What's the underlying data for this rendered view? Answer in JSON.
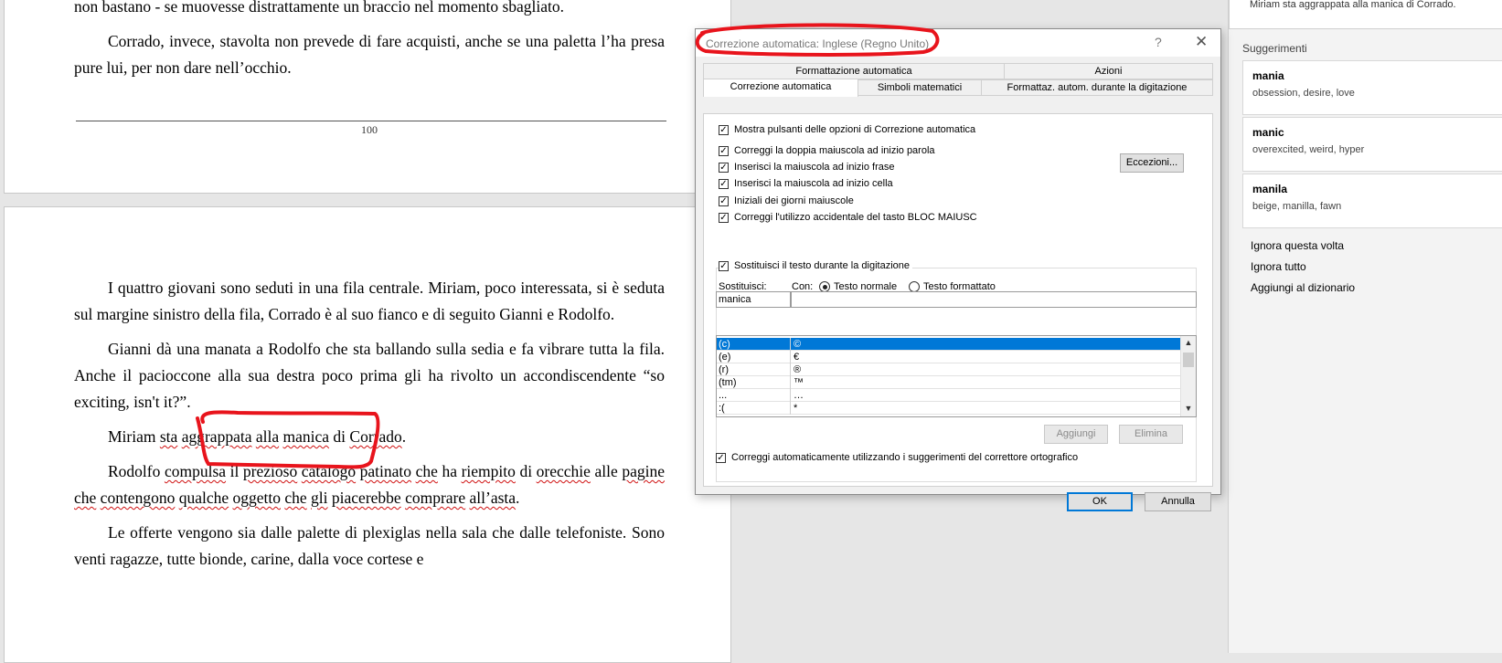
{
  "document": {
    "page1_paragraphs": [
      "non bastano - se muovesse distrattamente un braccio nel momento sbagliato.",
      "Corrado, invece, stavolta non prevede di fare acquisti, anche se una paletta l’ha presa pure lui, per non dare nell’occhio."
    ],
    "page_number": "100",
    "page2": {
      "p1": "I quattro giovani sono seduti in una fila centrale. Miriam, poco interessata, si è seduta sul margine sinistro della fila, Corrado è al suo fianco e di seguito Gianni e Rodolfo.",
      "p2": "Gianni dà una manata a Rodolfo che sta ballando sulla sedia e fa vibrare tutta la fila. Anche il pacioccone alla sua destra poco prima gli ha rivolto un accondiscendente “so exciting, isn't it?”.",
      "p3_words": [
        "Miriam ",
        "sta",
        " ",
        "aggrappata",
        " ",
        "alla",
        " ",
        "manica",
        " di ",
        "Corrado",
        "."
      ],
      "p4_words": [
        "Rodolfo ",
        "compulsa",
        " il ",
        "prezioso",
        " ",
        "catalogo",
        " ",
        "patinato",
        " ",
        "che",
        " ha ",
        "riempito",
        " di ",
        "orecchie",
        " alle ",
        "pagine",
        " ",
        "che",
        " ",
        "contengono",
        " ",
        "qualche",
        " ",
        "oggetto",
        " ",
        "che",
        " ",
        "gli",
        " ",
        "piacerebbe",
        " ",
        "comprare",
        " ",
        "all’asta",
        "."
      ],
      "p5": "Le offerte vengono sia dalle palette di plexiglas nella sala che dalle telefoniste. Sono venti ragazze, tutte bionde, carine, dalla voce cortese e"
    }
  },
  "pane": {
    "context": "Miriam sta aggrappata alla manica di Corrado.",
    "suggestions_header": "Suggerimenti",
    "suggestions": [
      {
        "word": "mania",
        "synonyms": "obsession, desire, love"
      },
      {
        "word": "manic",
        "synonyms": "overexcited, weird, hyper"
      },
      {
        "word": "manila",
        "synonyms": "beige, manilla, fawn"
      }
    ],
    "actions": [
      "Ignora questa volta",
      "Ignora tutto",
      "Aggiungi al dizionario"
    ]
  },
  "dialog": {
    "title": "Correzione automatica: Inglese (Regno Unito)",
    "help": "?",
    "close": "✕",
    "tabs_row1": [
      "Formattazione automatica",
      "Azioni"
    ],
    "tabs_row2": [
      "Correzione automatica",
      "Simboli matematici",
      "Formattaz. autom. durante la digitazione"
    ],
    "show_buttons": "Mostra pulsanti delle opzioni di Correzione automatica",
    "options": [
      "Correggi la doppia maiuscola ad inizio parola",
      "Inserisci la maiuscola ad inizio frase",
      "Inserisci la maiuscola ad inizio cella",
      "Iniziali dei giorni maiuscole",
      "Correggi l'utilizzo accidentale del tasto BLOC MAIUSC"
    ],
    "exceptions_button": "Eccezioni...",
    "replace_while_typing": "Sostituisci il testo durante la digitazione",
    "replace_label": "Sostituisci:",
    "with_label": "Con:",
    "radio_plain": "Testo normale",
    "radio_formatted": "Testo formattato",
    "replace_value": "manica",
    "with_value": "",
    "table": [
      {
        "from": "(c)",
        "to": "©"
      },
      {
        "from": "(e)",
        "to": "€"
      },
      {
        "from": "(r)",
        "to": "®"
      },
      {
        "from": "(tm)",
        "to": "™"
      },
      {
        "from": "...",
        "to": "…"
      },
      {
        "from": ":(",
        "to": "*"
      }
    ],
    "add_button": "Aggiungi",
    "delete_button": "Elimina",
    "auto_spell": "Correggi automaticamente utilizzando i suggerimenti del correttore ortografico",
    "ok_button": "OK",
    "cancel_button": "Annulla",
    "scroll_up": "▲",
    "scroll_down": "▼",
    "check": "✓"
  },
  "colors": {
    "selection": "#0078d7",
    "annotation": "#e8141c",
    "squiggle": "#d01010"
  }
}
